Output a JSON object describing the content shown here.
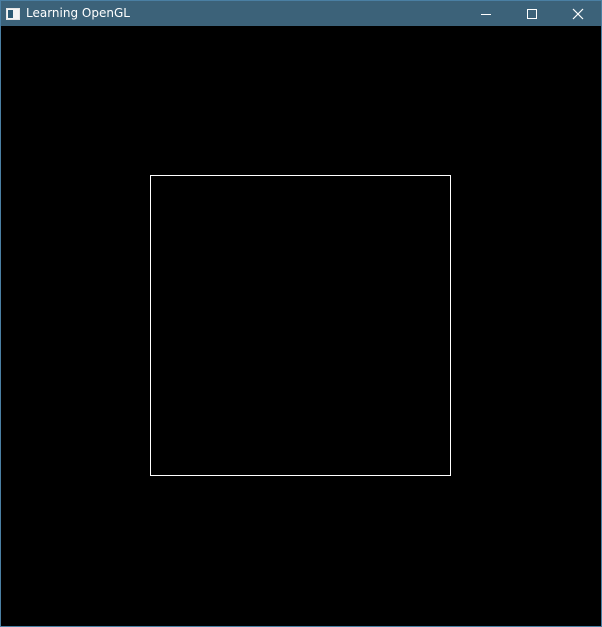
{
  "window": {
    "title": "Learning OpenGL",
    "app_icon": "application-window-icon",
    "controls": [
      {
        "name": "minimize",
        "icon": "minimize-icon"
      },
      {
        "name": "maximize",
        "icon": "maximize-icon"
      },
      {
        "name": "close",
        "icon": "close-icon"
      }
    ]
  },
  "colors": {
    "titlebar": "#3c6279",
    "title_text": "#ffffff",
    "clear_color": "#000000",
    "line_color": "#ffffff"
  },
  "scene": {
    "primitive": "wireframe-square",
    "vertices_ndc": [
      [
        -0.5,
        -0.5
      ],
      [
        0.5,
        -0.5
      ],
      [
        0.5,
        0.5
      ],
      [
        -0.5,
        0.5
      ]
    ]
  }
}
